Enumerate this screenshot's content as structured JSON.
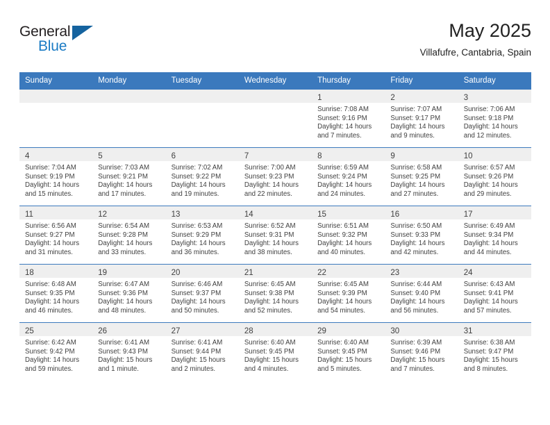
{
  "brand": {
    "name_top": "General",
    "name_bottom": "Blue",
    "triangle_color": "#15639f",
    "blue": "#1a7bc4"
  },
  "header": {
    "title": "May 2025",
    "subtitle": "Villafufre, Cantabria, Spain"
  },
  "theme": {
    "header_bg": "#3b79bd",
    "daynum_band_bg": "#efefef",
    "grid_line": "#3b79bd",
    "text": "#3f3f3f"
  },
  "weekday_headers": [
    "Sunday",
    "Monday",
    "Tuesday",
    "Wednesday",
    "Thursday",
    "Friday",
    "Saturday"
  ],
  "weeks": [
    [
      {
        "day": "",
        "sunrise": "",
        "sunset": "",
        "daylight_line1": "",
        "daylight_line2": ""
      },
      {
        "day": "",
        "sunrise": "",
        "sunset": "",
        "daylight_line1": "",
        "daylight_line2": ""
      },
      {
        "day": "",
        "sunrise": "",
        "sunset": "",
        "daylight_line1": "",
        "daylight_line2": ""
      },
      {
        "day": "",
        "sunrise": "",
        "sunset": "",
        "daylight_line1": "",
        "daylight_line2": ""
      },
      {
        "day": "1",
        "sunrise": "Sunrise: 7:08 AM",
        "sunset": "Sunset: 9:16 PM",
        "daylight_line1": "Daylight: 14 hours",
        "daylight_line2": "and 7 minutes."
      },
      {
        "day": "2",
        "sunrise": "Sunrise: 7:07 AM",
        "sunset": "Sunset: 9:17 PM",
        "daylight_line1": "Daylight: 14 hours",
        "daylight_line2": "and 9 minutes."
      },
      {
        "day": "3",
        "sunrise": "Sunrise: 7:06 AM",
        "sunset": "Sunset: 9:18 PM",
        "daylight_line1": "Daylight: 14 hours",
        "daylight_line2": "and 12 minutes."
      }
    ],
    [
      {
        "day": "4",
        "sunrise": "Sunrise: 7:04 AM",
        "sunset": "Sunset: 9:19 PM",
        "daylight_line1": "Daylight: 14 hours",
        "daylight_line2": "and 15 minutes."
      },
      {
        "day": "5",
        "sunrise": "Sunrise: 7:03 AM",
        "sunset": "Sunset: 9:21 PM",
        "daylight_line1": "Daylight: 14 hours",
        "daylight_line2": "and 17 minutes."
      },
      {
        "day": "6",
        "sunrise": "Sunrise: 7:02 AM",
        "sunset": "Sunset: 9:22 PM",
        "daylight_line1": "Daylight: 14 hours",
        "daylight_line2": "and 19 minutes."
      },
      {
        "day": "7",
        "sunrise": "Sunrise: 7:00 AM",
        "sunset": "Sunset: 9:23 PM",
        "daylight_line1": "Daylight: 14 hours",
        "daylight_line2": "and 22 minutes."
      },
      {
        "day": "8",
        "sunrise": "Sunrise: 6:59 AM",
        "sunset": "Sunset: 9:24 PM",
        "daylight_line1": "Daylight: 14 hours",
        "daylight_line2": "and 24 minutes."
      },
      {
        "day": "9",
        "sunrise": "Sunrise: 6:58 AM",
        "sunset": "Sunset: 9:25 PM",
        "daylight_line1": "Daylight: 14 hours",
        "daylight_line2": "and 27 minutes."
      },
      {
        "day": "10",
        "sunrise": "Sunrise: 6:57 AM",
        "sunset": "Sunset: 9:26 PM",
        "daylight_line1": "Daylight: 14 hours",
        "daylight_line2": "and 29 minutes."
      }
    ],
    [
      {
        "day": "11",
        "sunrise": "Sunrise: 6:56 AM",
        "sunset": "Sunset: 9:27 PM",
        "daylight_line1": "Daylight: 14 hours",
        "daylight_line2": "and 31 minutes."
      },
      {
        "day": "12",
        "sunrise": "Sunrise: 6:54 AM",
        "sunset": "Sunset: 9:28 PM",
        "daylight_line1": "Daylight: 14 hours",
        "daylight_line2": "and 33 minutes."
      },
      {
        "day": "13",
        "sunrise": "Sunrise: 6:53 AM",
        "sunset": "Sunset: 9:29 PM",
        "daylight_line1": "Daylight: 14 hours",
        "daylight_line2": "and 36 minutes."
      },
      {
        "day": "14",
        "sunrise": "Sunrise: 6:52 AM",
        "sunset": "Sunset: 9:31 PM",
        "daylight_line1": "Daylight: 14 hours",
        "daylight_line2": "and 38 minutes."
      },
      {
        "day": "15",
        "sunrise": "Sunrise: 6:51 AM",
        "sunset": "Sunset: 9:32 PM",
        "daylight_line1": "Daylight: 14 hours",
        "daylight_line2": "and 40 minutes."
      },
      {
        "day": "16",
        "sunrise": "Sunrise: 6:50 AM",
        "sunset": "Sunset: 9:33 PM",
        "daylight_line1": "Daylight: 14 hours",
        "daylight_line2": "and 42 minutes."
      },
      {
        "day": "17",
        "sunrise": "Sunrise: 6:49 AM",
        "sunset": "Sunset: 9:34 PM",
        "daylight_line1": "Daylight: 14 hours",
        "daylight_line2": "and 44 minutes."
      }
    ],
    [
      {
        "day": "18",
        "sunrise": "Sunrise: 6:48 AM",
        "sunset": "Sunset: 9:35 PM",
        "daylight_line1": "Daylight: 14 hours",
        "daylight_line2": "and 46 minutes."
      },
      {
        "day": "19",
        "sunrise": "Sunrise: 6:47 AM",
        "sunset": "Sunset: 9:36 PM",
        "daylight_line1": "Daylight: 14 hours",
        "daylight_line2": "and 48 minutes."
      },
      {
        "day": "20",
        "sunrise": "Sunrise: 6:46 AM",
        "sunset": "Sunset: 9:37 PM",
        "daylight_line1": "Daylight: 14 hours",
        "daylight_line2": "and 50 minutes."
      },
      {
        "day": "21",
        "sunrise": "Sunrise: 6:45 AM",
        "sunset": "Sunset: 9:38 PM",
        "daylight_line1": "Daylight: 14 hours",
        "daylight_line2": "and 52 minutes."
      },
      {
        "day": "22",
        "sunrise": "Sunrise: 6:45 AM",
        "sunset": "Sunset: 9:39 PM",
        "daylight_line1": "Daylight: 14 hours",
        "daylight_line2": "and 54 minutes."
      },
      {
        "day": "23",
        "sunrise": "Sunrise: 6:44 AM",
        "sunset": "Sunset: 9:40 PM",
        "daylight_line1": "Daylight: 14 hours",
        "daylight_line2": "and 56 minutes."
      },
      {
        "day": "24",
        "sunrise": "Sunrise: 6:43 AM",
        "sunset": "Sunset: 9:41 PM",
        "daylight_line1": "Daylight: 14 hours",
        "daylight_line2": "and 57 minutes."
      }
    ],
    [
      {
        "day": "25",
        "sunrise": "Sunrise: 6:42 AM",
        "sunset": "Sunset: 9:42 PM",
        "daylight_line1": "Daylight: 14 hours",
        "daylight_line2": "and 59 minutes."
      },
      {
        "day": "26",
        "sunrise": "Sunrise: 6:41 AM",
        "sunset": "Sunset: 9:43 PM",
        "daylight_line1": "Daylight: 15 hours",
        "daylight_line2": "and 1 minute."
      },
      {
        "day": "27",
        "sunrise": "Sunrise: 6:41 AM",
        "sunset": "Sunset: 9:44 PM",
        "daylight_line1": "Daylight: 15 hours",
        "daylight_line2": "and 2 minutes."
      },
      {
        "day": "28",
        "sunrise": "Sunrise: 6:40 AM",
        "sunset": "Sunset: 9:45 PM",
        "daylight_line1": "Daylight: 15 hours",
        "daylight_line2": "and 4 minutes."
      },
      {
        "day": "29",
        "sunrise": "Sunrise: 6:40 AM",
        "sunset": "Sunset: 9:45 PM",
        "daylight_line1": "Daylight: 15 hours",
        "daylight_line2": "and 5 minutes."
      },
      {
        "day": "30",
        "sunrise": "Sunrise: 6:39 AM",
        "sunset": "Sunset: 9:46 PM",
        "daylight_line1": "Daylight: 15 hours",
        "daylight_line2": "and 7 minutes."
      },
      {
        "day": "31",
        "sunrise": "Sunrise: 6:38 AM",
        "sunset": "Sunset: 9:47 PM",
        "daylight_line1": "Daylight: 15 hours",
        "daylight_line2": "and 8 minutes."
      }
    ]
  ]
}
